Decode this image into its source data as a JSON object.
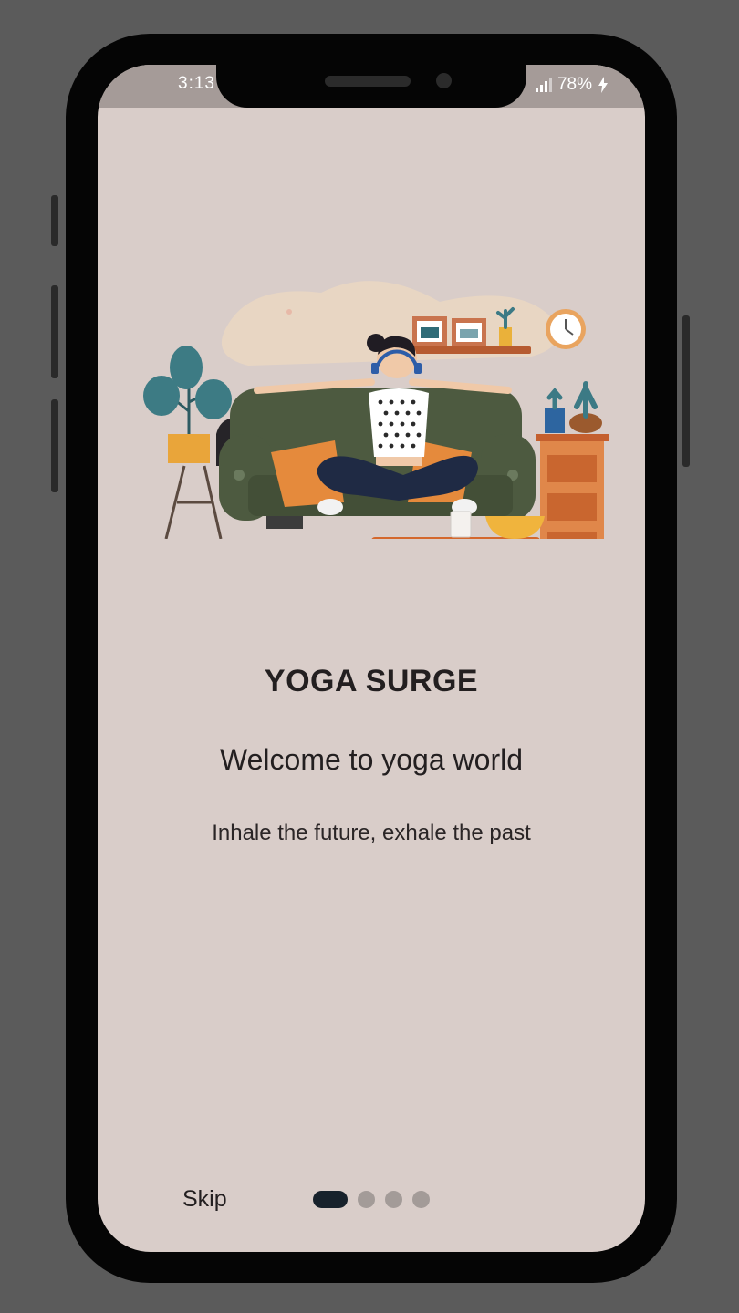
{
  "status_bar": {
    "time": "3:13",
    "battery": "78%",
    "icons": [
      "signal-icon",
      "charging-bolt-icon"
    ]
  },
  "onboarding": {
    "title": "YOGA SURGE",
    "subtitle": "Welcome to yoga world",
    "caption": "Inhale the future, exhale the past",
    "illustration": "woman-meditating-on-sofa-illustration"
  },
  "footer": {
    "skip_label": "Skip",
    "page_indicator": {
      "total": 4,
      "current": 1
    }
  },
  "colors": {
    "screen_background": "#d9cdc9",
    "status_bar": "#a59b98",
    "text": "#231f20",
    "active_dot": "#17212b",
    "inactive_dot": "#a39b98"
  }
}
